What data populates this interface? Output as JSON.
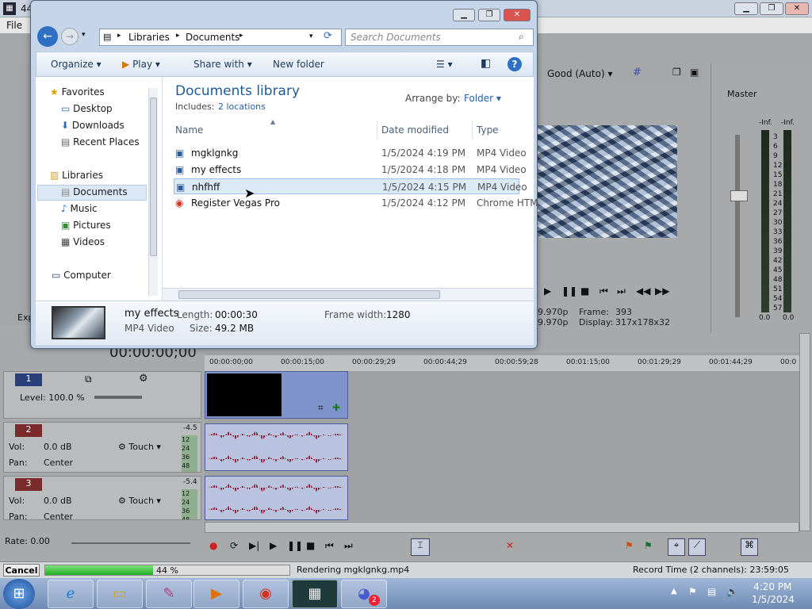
{
  "vegas": {
    "title": "44",
    "menu_file": "File",
    "preview_quality": "Good (Auto)",
    "preview_info": [
      {
        "label": "",
        "value": "9.970p"
      },
      {
        "label": "Frame:",
        "value": "393"
      },
      {
        "label": "",
        "value": "9.970p"
      },
      {
        "label": "Display:",
        "value": "317x178x32"
      }
    ],
    "master_label": "Master",
    "meter_inf_left": "-Inf.",
    "meter_inf_right": "-Inf.",
    "meter_scale": [
      "3",
      "6",
      "9",
      "12",
      "15",
      "18",
      "21",
      "24",
      "27",
      "30",
      "33",
      "36",
      "39",
      "42",
      "45",
      "48",
      "51",
      "54",
      "57"
    ],
    "meter_bottom_left": "0.0",
    "meter_bottom_right": "0.0",
    "exp_label": "Exp",
    "timecode": "00:00:00;00",
    "ruler_ticks": [
      "00:00:00;00",
      "00:00:15;00",
      "00:00:29;29",
      "00:00:44;29",
      "00:00:59;28",
      "00:01:15;00",
      "00:01:29;29",
      "00:01:44;29",
      "00:0"
    ],
    "tracks": [
      {
        "num": "1",
        "line1_label": "Level: 100.0 %"
      },
      {
        "num": "2",
        "vol_label": "Vol:",
        "vol_value": "0.0 dB",
        "pan_label": "Pan:",
        "pan_value": "Center",
        "mode": "Touch",
        "meter_top": "-4.5",
        "meter_scale": [
          "12",
          "24",
          "36",
          "48"
        ]
      },
      {
        "num": "3",
        "vol_label": "Vol:",
        "vol_value": "0.0 dB",
        "pan_label": "Pan:",
        "pan_value": "Center",
        "mode": "Touch",
        "meter_top": "-5.4",
        "meter_scale": [
          "12",
          "24",
          "36",
          "48"
        ]
      }
    ],
    "rate_label": "Rate: 0.00",
    "cancel_label": "Cancel",
    "progress_percent": 44,
    "progress_text": "44 %",
    "rendering_text": "Rendering mgklgnkg.mp4",
    "record_time": "Record Time (2 channels): 23:59:05"
  },
  "dialog": {
    "address": [
      "Libraries",
      "Documents"
    ],
    "search_placeholder": "Search Documents",
    "commands": {
      "organize": "Organize",
      "play": "Play",
      "share": "Share with",
      "new_folder": "New folder"
    },
    "nav": {
      "favorites": "Favorites",
      "fav_items": [
        "Desktop",
        "Downloads",
        "Recent Places"
      ],
      "libraries": "Libraries",
      "lib_items": [
        "Documents",
        "Music",
        "Pictures",
        "Videos"
      ],
      "computer": "Computer"
    },
    "library_title": "Documents library",
    "includes_label": "Includes:",
    "includes_link": "2 locations",
    "arrange_label": "Arrange by:",
    "arrange_value": "Folder",
    "columns": {
      "name": "Name",
      "date": "Date modified",
      "type": "Type"
    },
    "files": [
      {
        "name": "mgklgnkg",
        "date": "1/5/2024 4:19 PM",
        "type": "MP4 Video",
        "icon": "video-file-icon"
      },
      {
        "name": "my effects",
        "date": "1/5/2024 4:18 PM",
        "type": "MP4 Video",
        "icon": "video-file-icon"
      },
      {
        "name": "nhfhff",
        "date": "1/5/2024 4:15 PM",
        "type": "MP4 Video",
        "icon": "video-file-icon"
      },
      {
        "name": "Register Vegas Pro",
        "date": "1/5/2024 4:12 PM",
        "type": "Chrome HTM",
        "icon": "chrome-icon"
      }
    ],
    "details": {
      "name": "my effects",
      "kind": "MP4 Video",
      "length_label": "Length:",
      "length_value": "00:00:30",
      "size_label": "Size:",
      "size_value": "49.2 MB",
      "width_label": "Frame width:",
      "width_value": "1280"
    }
  },
  "taskbar": {
    "time": "4:20 PM",
    "date": "1/5/2024",
    "discord_badge": "2"
  }
}
